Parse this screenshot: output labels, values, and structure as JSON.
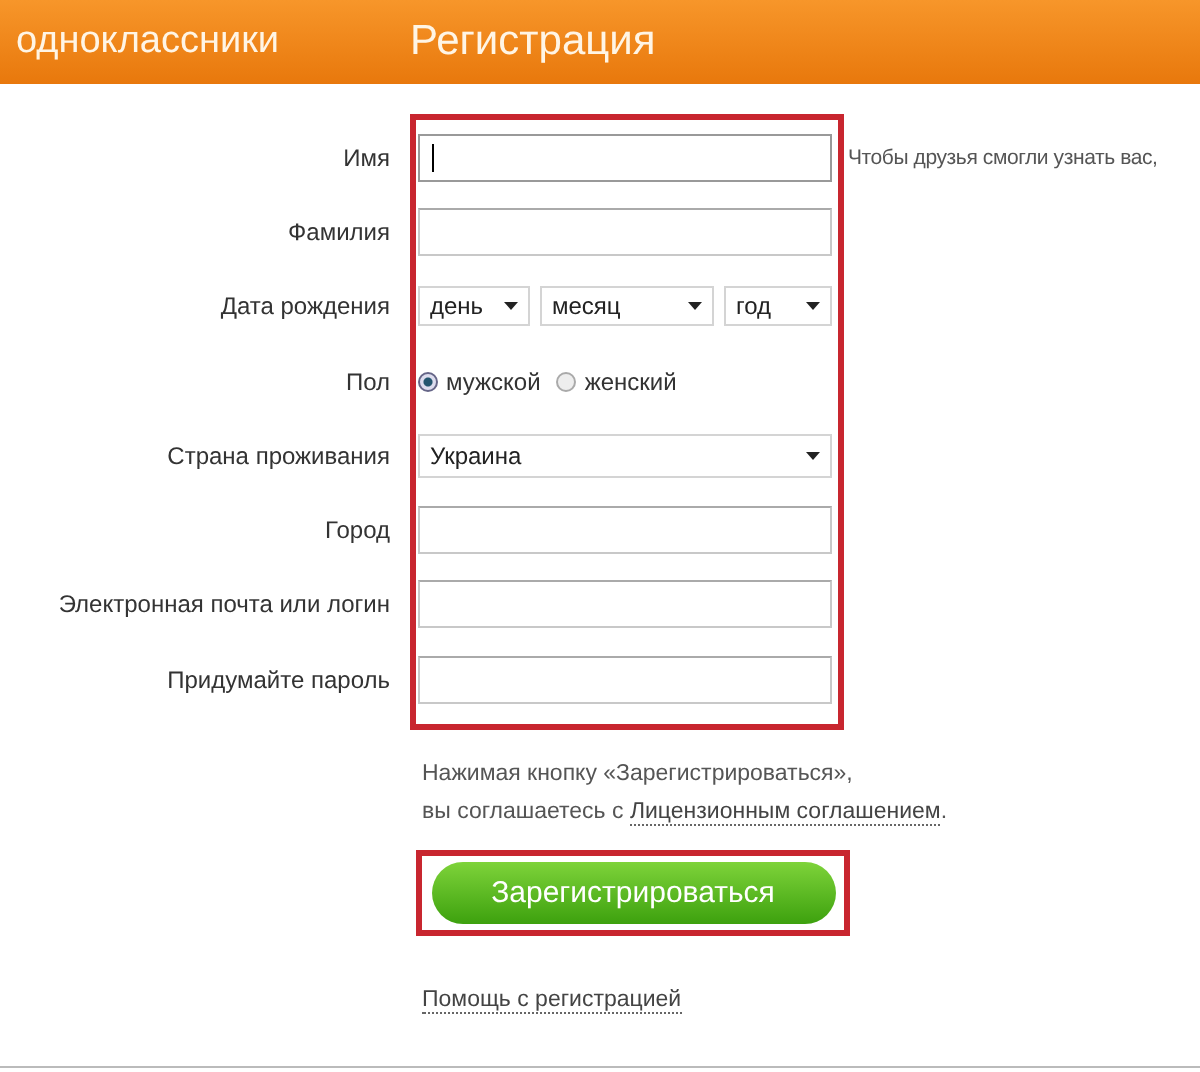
{
  "header": {
    "logo": "одноклассники",
    "title": "Регистрация"
  },
  "fields": [
    {
      "kind": "text",
      "label": "Имя",
      "focused": true,
      "hint": "Чтобы друзья смогли узнать вас,"
    },
    {
      "kind": "text",
      "label": "Фамилия",
      "focused": false
    },
    {
      "kind": "date",
      "label": "Дата рождения",
      "selects": [
        "день",
        "месяц",
        "год"
      ]
    },
    {
      "kind": "radio",
      "label": "Пол",
      "options": [
        {
          "label": "мужской",
          "selected": true
        },
        {
          "label": "женский",
          "selected": false
        }
      ]
    },
    {
      "kind": "select",
      "label": "Страна проживания",
      "value": "Украина"
    },
    {
      "kind": "text",
      "label": "Город",
      "focused": false
    },
    {
      "kind": "text",
      "label": "Электронная почта или логин",
      "focused": false
    },
    {
      "kind": "text",
      "label": "Придумайте пароль",
      "focused": false
    }
  ],
  "terms": {
    "line_1": "Нажимая кнопку «Зарегистрироваться»,",
    "line_2": "вы соглашаетесь с ",
    "link": "Лицензионным соглашением",
    "end": "."
  },
  "submit": "Зарегистрироваться",
  "help_link": "Помощь с регистрацией"
}
